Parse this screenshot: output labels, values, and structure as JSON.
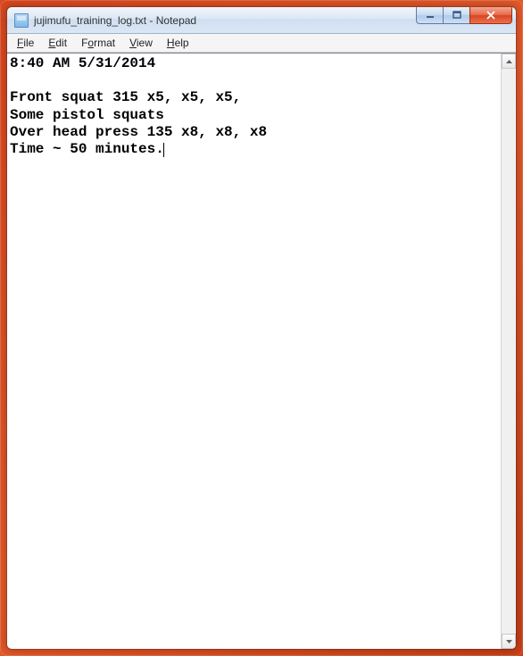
{
  "window": {
    "title": "jujimufu_training_log.txt - Notepad",
    "icon": "notepad-icon"
  },
  "menu": {
    "items": [
      {
        "label": "File",
        "accel": "F"
      },
      {
        "label": "Edit",
        "accel": "E"
      },
      {
        "label": "Format",
        "accel": "o"
      },
      {
        "label": "View",
        "accel": "V"
      },
      {
        "label": "Help",
        "accel": "H"
      }
    ]
  },
  "document": {
    "content": "8:40 AM 5/31/2014\n\nFront squat 315 x5, x5, x5,\nSome pistol squats\nOver head press 135 x8, x8, x8\nTime ~ 50 minutes."
  }
}
